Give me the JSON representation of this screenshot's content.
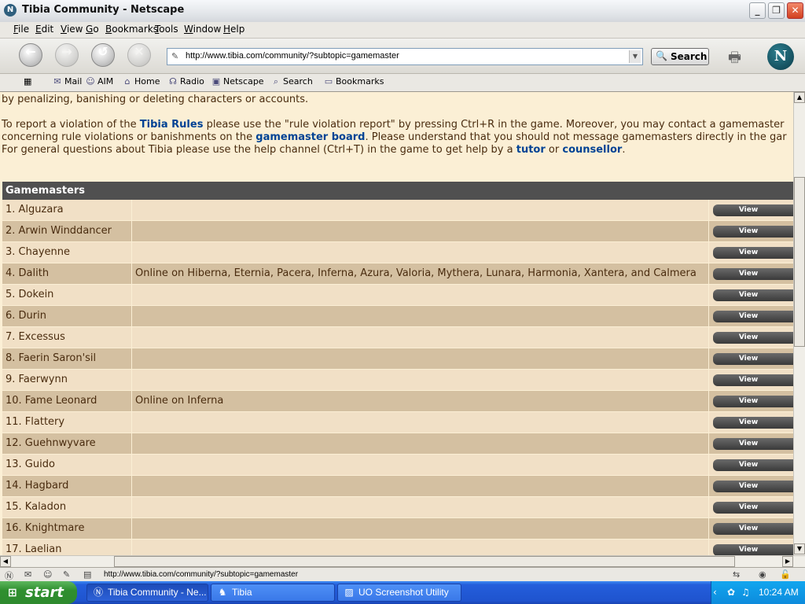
{
  "window": {
    "title": "Tibia Community - Netscape"
  },
  "menu": [
    "File",
    "Edit",
    "View",
    "Go",
    "Bookmarks",
    "Tools",
    "Window",
    "Help"
  ],
  "nav": {
    "url": "http://www.tibia.com/community/?subtopic=gamemaster",
    "search_label": "Search",
    "logo": "N"
  },
  "personal_toolbar": [
    {
      "icon": "mail-icon",
      "label": "Mail"
    },
    {
      "icon": "aim-icon",
      "label": "AIM"
    },
    {
      "icon": "home-icon",
      "label": "Home"
    },
    {
      "icon": "radio-icon",
      "label": "Radio"
    },
    {
      "icon": "my-netscape-icon",
      "label": "Netscape"
    },
    {
      "icon": "search-icon",
      "label": "Search"
    },
    {
      "icon": "bookmarks-folder-icon",
      "label": "Bookmarks"
    }
  ],
  "content": {
    "line0": "by penalizing, banishing or deleting characters or accounts.",
    "line1_a": "To report a violation of the ",
    "line1_link": "Tibia Rules",
    "line1_b": " please use the \"rule violation report\" by pressing Ctrl+R in the game. Moreover, you may contact a gamemaster",
    "line2_a": "concerning rule violations or banishments on the ",
    "line2_link": "gamemaster board",
    "line2_b": ". Please understand that you should not message gamemasters directly in the gar",
    "line3_a": "For general questions about Tibia please use the help channel (Ctrl+T) in the game to get help by a ",
    "line3_link1": "tutor",
    "line3_mid": " or ",
    "line3_link2": "counsellor",
    "line3_end": "."
  },
  "table": {
    "header": "Gamemasters",
    "view_label": "View",
    "rows": [
      {
        "name": "1. Alguzara",
        "status": ""
      },
      {
        "name": "2. Arwin Winddancer",
        "status": ""
      },
      {
        "name": "3. Chayenne",
        "status": ""
      },
      {
        "name": "4. Dalith",
        "status": "Online on Hiberna, Eternia, Pacera, Inferna, Azura, Valoria, Mythera, Lunara, Harmonia, Xantera, and Calmera"
      },
      {
        "name": "5. Dokein",
        "status": ""
      },
      {
        "name": "6. Durin",
        "status": ""
      },
      {
        "name": "7. Excessus",
        "status": ""
      },
      {
        "name": "8. Faerin Saron'sil",
        "status": ""
      },
      {
        "name": "9. Faerwynn",
        "status": ""
      },
      {
        "name": "10. Fame Leonard",
        "status": "Online on Inferna"
      },
      {
        "name": "11. Flattery",
        "status": ""
      },
      {
        "name": "12. Guehnwyvare",
        "status": ""
      },
      {
        "name": "13. Guido",
        "status": ""
      },
      {
        "name": "14. Hagbard",
        "status": ""
      },
      {
        "name": "15. Kaladon",
        "status": ""
      },
      {
        "name": "16. Knightmare",
        "status": ""
      },
      {
        "name": "17. Laelian",
        "status": ""
      }
    ]
  },
  "status_bar": {
    "text": "http://www.tibia.com/community/?subtopic=gamemaster"
  },
  "taskbar": {
    "start": "start",
    "tasks": [
      {
        "icon": "netscape-icon",
        "label": "Tibia Community - Ne...",
        "active": true
      },
      {
        "icon": "tibia-icon",
        "label": "Tibia",
        "active": false
      },
      {
        "icon": "screenshot-utility-icon",
        "label": "UO Screenshot Utility",
        "active": false
      }
    ],
    "clock": "10:24 AM"
  },
  "colors": {
    "content_bg": "#fbefd5",
    "text": "#4a2c0f",
    "link": "#004294",
    "header_bg": "#505050",
    "row_light": "#f1e0c6",
    "row_dark": "#d4c0a1"
  }
}
